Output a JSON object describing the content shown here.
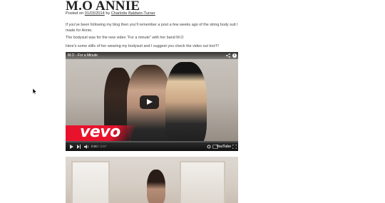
{
  "post": {
    "title": "M.O ANNIE",
    "meta_posted_on": "Posted on",
    "meta_date": "01/03/2014",
    "meta_by": "by",
    "meta_author": "Charlotte Baldwin-Turner",
    "paragraphs": [
      "If you've been following my blog then you'll remember a post a few weeks ago of the string body suit I made for Annie.",
      "The bodysuit was for the new video “For a minute” with her band M.O",
      "Here's some stills of her wearing my bodysuit and I suggest you check the video out too!!!!"
    ]
  },
  "video": {
    "title": "M.O - For a Minute",
    "brand": "vevo",
    "current_time": "0:00",
    "duration": "/ 2:57",
    "platform": "YouTube"
  },
  "colors": {
    "vevo_red": "#e8122d",
    "control_bar": "#111111"
  },
  "icons": [
    "share-icon",
    "info-icon",
    "play-icon",
    "next-icon",
    "volume-icon",
    "settings-icon",
    "captions-icon",
    "fullscreen-icon",
    "cursor-icon"
  ]
}
